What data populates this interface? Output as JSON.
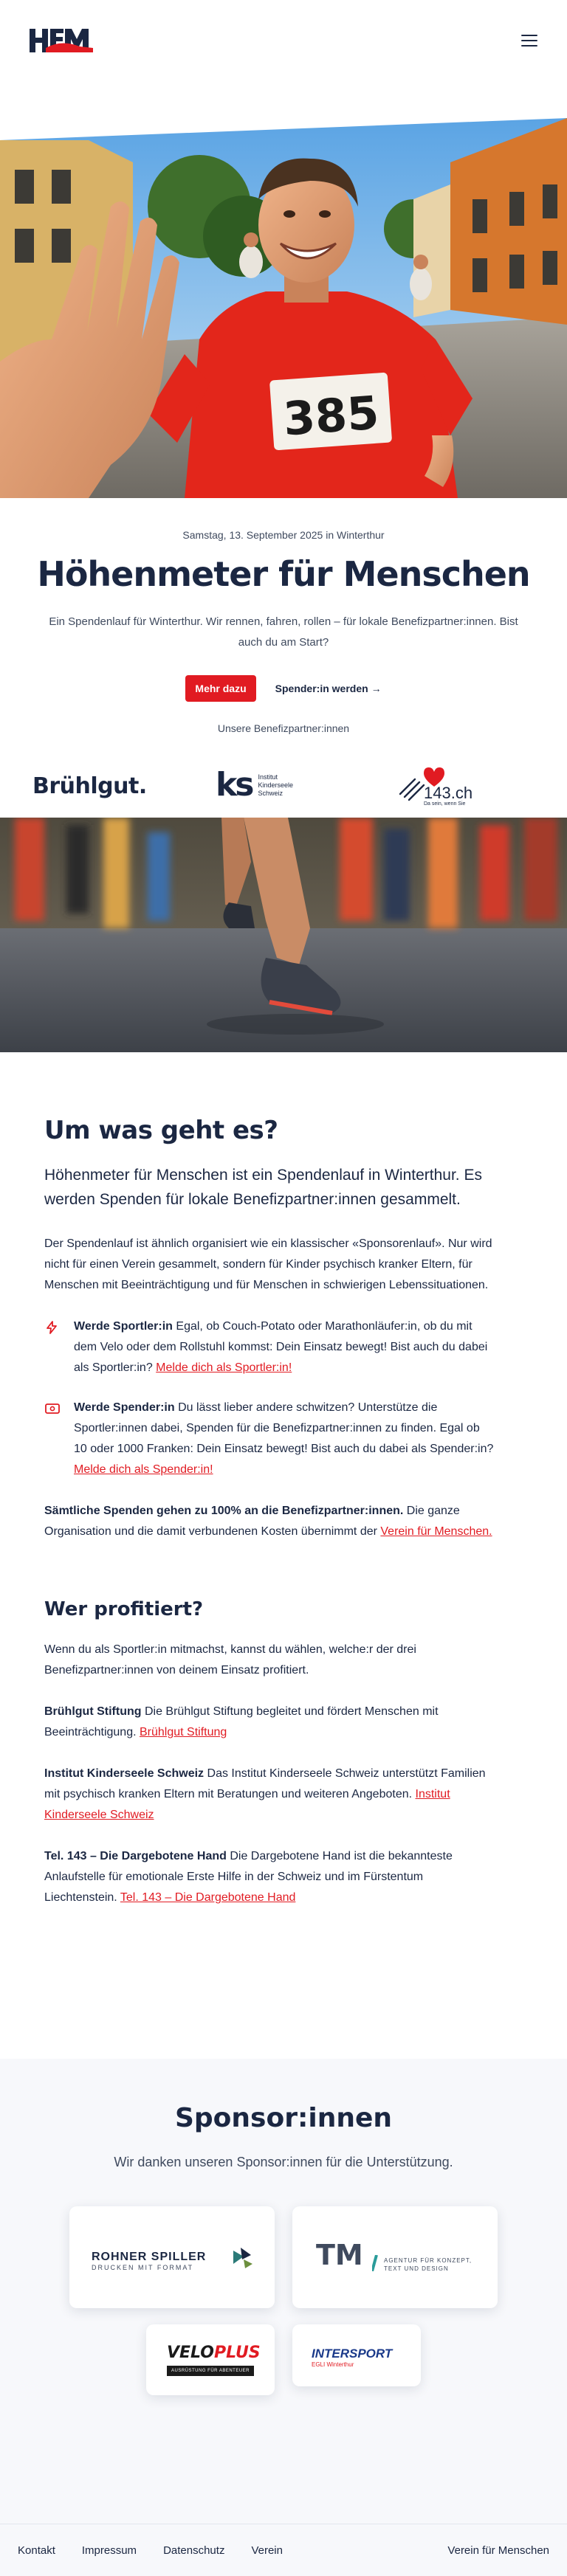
{
  "header": {
    "logo_alt": "HfM",
    "menu_icon": "hamburger-menu-icon"
  },
  "hero": {
    "date": "Samstag, 13. September 2025 in Winterthur",
    "title": "Höhenmeter für Menschen",
    "lead": "Ein Spendenlauf für Winterthur. Wir rennen, fahren, rollen – für lokale Benefizpartner:innen. Bist auch du am Start?",
    "cta_primary": "Mehr dazu",
    "cta_secondary": "Spender:in werden →",
    "bib_number": "385",
    "partners_label": "Unsere Benefizpartner:innen"
  },
  "partners": {
    "bruehlgut": "Brühlgut.",
    "kinderseele_mark": "ks",
    "kinderseele_text": [
      "Institut",
      "Kinderseele",
      "Schweiz"
    ],
    "tel143": "143.ch",
    "tel143_sub": "Da sein, wenn Sie"
  },
  "about": {
    "title": "Um was geht es?",
    "lead": "Höhenmeter für Menschen ist ein Spendenlauf in Winterthur. Es werden Spenden für lokale Benefizpartner:innen gesammelt.",
    "intro": "Der Spendenlauf ist ähnlich organisiert wie ein klassischer «Sponsorenlauf». Nur wird nicht für einen Verein gesammelt, sondern für Kinder psychisch kranker Eltern, für Menschen mit Beeinträchtigung und für Menschen in schwierigen Lebenssituationen.",
    "feature1_title": "Werde Sportler:in",
    "feature1_text": " Egal, ob Couch-Potato oder Marathonläufer:in, ob du mit dem Velo oder dem Rollstuhl kommst: Dein Einsatz bewegt! Bist auch du dabei als Sportler:in? ",
    "feature1_link": "Melde dich als Sportler:in!",
    "feature2_title": "Werde Spender:in",
    "feature2_text": " Du lässt lieber andere schwitzen? Unterstütze die Sportler:innen dabei, Spenden für die Benefizpartner:innen zu finden. Egal ob 10 oder 1000 Franken: Dein Einsatz bewegt! Bist auch du dabei als Spender:in? ",
    "feature2_link": "Melde dich als Spender:in!",
    "donations_bold": "Sämtliche Spenden gehen zu 100% an die Benefizpartner:innen.",
    "donations_text": " Die ganze Organisation und die damit verbundenen Kosten übernimmt der ",
    "donations_link": "Verein für Menschen."
  },
  "benefit": {
    "title": "Wer profitiert?",
    "intro": "Wenn du als Sportler:in mitmachst, kannst du wählen, welche:r der drei Benefizpartner:innen von deinem Einsatz profitiert.",
    "items": [
      {
        "name": "Brühlgut Stiftung",
        "text": " Die Brühlgut Stiftung begleitet und fördert Menschen mit Beeinträchtigung. ",
        "link": "Brühlgut Stiftung"
      },
      {
        "name": "Institut Kinderseele Schweiz",
        "text": " Das Institut Kinderseele Schweiz unterstützt Familien mit psychisch kranken Eltern mit Beratungen und weiteren Angeboten. ",
        "link": "Institut Kinderseele Schweiz"
      },
      {
        "name": "Tel. 143 – Die Dargebotene Hand",
        "text": " Die Dargebotene Hand ist die bekannteste Anlaufstelle für emotionale Erste Hilfe in der Schweiz und im Fürstentum Liechtenstein. ",
        "link": "Tel. 143 – Die Dargebotene Hand"
      }
    ]
  },
  "sponsors": {
    "title": "Sponsor:innen",
    "subtitle": "Wir danken unseren Sponsor:innen für die Unterstützung.",
    "rohner_name": "ROHNER SPILLER",
    "rohner_sub": "DRUCKEN MIT FORMAT",
    "tm_mark": "TM",
    "tm_text": [
      "AGENTUR FÜR KONZEPT,",
      "TEXT UND DESIGN"
    ],
    "veloplus_a": "VELO",
    "veloplus_b": "PLUS",
    "veloplus_sub": "AUSRÜSTUNG FÜR ABENTEUER",
    "intersport": "INTERSPORT",
    "intersport_sub": "EGLI Winterthur"
  },
  "footer": {
    "links": [
      "Kontakt",
      "Impressum",
      "Datenschutz",
      "Verein"
    ],
    "right": "Verein für Menschen"
  },
  "colors": {
    "navy": "#1b2742",
    "red": "#e11b22",
    "background": "#ffffff",
    "light": "#f7f8fb"
  }
}
